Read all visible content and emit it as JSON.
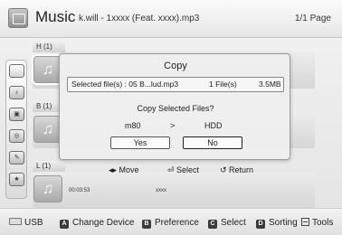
{
  "header": {
    "app_title": "Music",
    "file_title": "k.will - 1xxxx (Feat. xxxx).mp3",
    "page": "1/1 Page"
  },
  "groups": [
    {
      "label": "H  (1)"
    },
    {
      "label": "B  (1)"
    },
    {
      "label": "L  (1)"
    }
  ],
  "thumb_glyph": "♫",
  "track_meta": {
    "time": "00:03:53",
    "artist": "xxxx"
  },
  "rail_icons": [
    "folder-icon",
    "music-icon",
    "photo-icon",
    "disc-icon",
    "edit-icon",
    "star-icon"
  ],
  "dialog": {
    "title": "Copy",
    "selected_text": "Selected file(s) : 05 B...lud.mp3",
    "file_count": "1 File(s)",
    "size": "3.5MB",
    "question": "Copy Selected Files?",
    "source": "m80",
    "arrow": ">",
    "destination": "HDD",
    "yes_label": "Yes",
    "no_label": "No"
  },
  "hints": {
    "move": "◂▸ Move",
    "select": "⏎ Select",
    "return": "↺ Return"
  },
  "footer": {
    "usb": "USB",
    "a_key": "A",
    "a_label": "Change Device",
    "b_key": "B",
    "b_label": "Preference",
    "c_key": "C",
    "c_label": "Select",
    "d_key": "D",
    "d_label": "Sorting",
    "tools_label": "Tools"
  }
}
